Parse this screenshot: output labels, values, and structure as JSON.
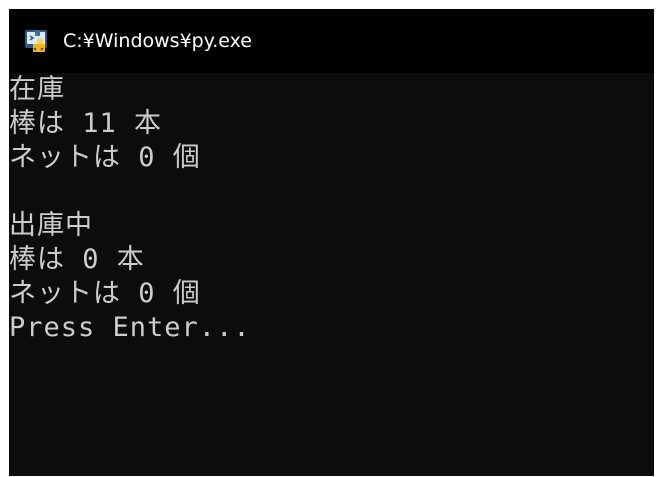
{
  "window": {
    "title": "C:¥Windows¥py.exe",
    "icon": "python-icon",
    "background_color": "#0c0c0c",
    "text_color": "#cccccc"
  },
  "console": {
    "lines": [
      "在庫",
      "棒は 11 本",
      "ネットは 0 個",
      "",
      "出庫中",
      "棒は 0 本",
      "ネットは 0 個",
      "Press Enter..."
    ]
  }
}
